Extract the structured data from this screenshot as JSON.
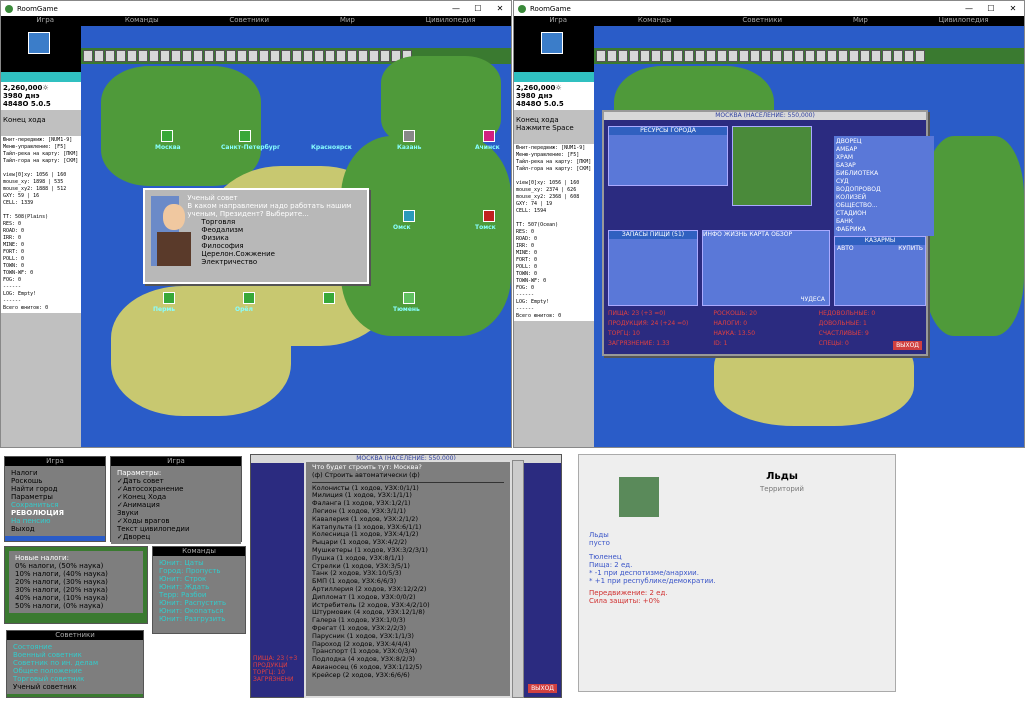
{
  "app_title": "RoomGame",
  "window_controls": [
    "—",
    "☐",
    "✕"
  ],
  "menus": [
    "Игра",
    "Команды",
    "Советники",
    "Мир",
    "Цивилопедия"
  ],
  "left_window": {
    "stats": [
      "2,260,000☼",
      "3980 днэ",
      "4848О 5.0.5"
    ],
    "status": "Конец хода",
    "debug": "Юнит-передвиж: [NUM1-9]\nМеню-управление: [F5]\nТайл-река на карту: [ПКМ]\nТайл-гора на карту: [СКМ]\n\nview[0]xy: 1056 | 160\nmouse_xy: 1898 | 535\nmouse_xy2: 1888 | 512\nGXY: 59 | 16\nCELL: 1339\n\nTT: 508(Plains)\nRES: 0\nROAD: 0\nIRR: 0\nMINE: 0\nFORT: 0\nPOLL: 0\nTOWN: 0\nTOWN-WF: 0\nFOG: 0\n------\nLOG: Empty!\n------\nВсего юнитов: 0",
    "cities": [
      "Москва",
      "Санкт-Петербург",
      "Красноярск",
      "Казань",
      "Ачинск",
      "Омск",
      "Томск",
      "Пермь",
      "Орёл",
      "Тюмень"
    ],
    "advisor": {
      "title": "Ученый совет",
      "question": "В каком направлении надо работать нашим ученым, Президент? Выберите...",
      "options": [
        "Торговля",
        "Феодализм",
        "Физика",
        "Философия",
        "Церелон.Сожжение",
        "Электричество"
      ]
    }
  },
  "right_window": {
    "stats": [
      "2,260,000☼",
      "3980 днэ",
      "4848О 5.0.5"
    ],
    "status": [
      "Конец хода",
      "Нажмите Space"
    ],
    "debug": "Юнит-передвиж: [NUM1-9]\nМеню-управление: [F5]\nТайл-река на карту: [ПКМ]\nТайл-гора на карту: [СКМ]\n\nview[0]xy: 1056 | 160\nmouse_xy: 2374 | 626\nmouse_xy2: 2368 | 608\nGXY: 74 | 19\nCELL: 1594\n\nTT: 507(Ocean)\nRES: 0\nROAD: 0\nIRR: 0\nMINE: 0\nFORT: 0\nPOLL: 0\nTOWN: 0\nTOWN-WF: 0\nFOG: 0\n------\nLOG: Empty!\n------\nВсего юнитов: 0",
    "city_window": {
      "title": "МОСКВА (НАСЕЛЕНИЕ: 550,000)",
      "resources": "РЕСУРСЫ ГОРОДА",
      "food_box": "ЗАПАСЫ ПИЩИ (51)",
      "tabs": [
        "ИНФО",
        "ЖИЗНЬ",
        "КАРТА",
        "ОБЗОР"
      ],
      "barracks": "КАЗАРМЫ",
      "auto": "АВТО",
      "buy": "КУПИТЬ",
      "wonders": "ЧУДЕСА",
      "buildings": [
        "ДВОРЕЦ",
        "АМБАР",
        "ХРАМ",
        "БАЗАР",
        "БИБЛИОТЕКА",
        "СУД",
        "ВОДОПРОВОД",
        "КОЛИЗЕЙ",
        "ОБЩЕСТВО...",
        "СТАДИОН",
        "БАНК",
        "ФАБРИКА",
        "СОЦ"
      ],
      "info": [
        "ПИЩА: 23 (+3 =0)",
        "ПРОДУКЦИЯ: 24 (+24 =0)",
        "ТОРГЦ: 10",
        "РОСКОШЬ: 20",
        "НАЛОГИ: 0",
        "НАУКА: 13.50",
        "НЕДОВОЛЬНЫЕ: 0",
        "ДОВОЛЬНЫЕ: 1",
        "СЧАСТЛИВЫЕ: 9",
        "СПЕЦЫ: 0",
        "ЗАГРЯЗНЕНИЕ: 1.33",
        "ID: 1"
      ],
      "exit": "ВЫХОД"
    }
  },
  "game_menu": {
    "header": "Игра",
    "items": [
      "Налоги",
      "Роскошь",
      "Найти город",
      "Параметры",
      "Сохраниться",
      "РЕВОЛЮЦИЯ",
      "",
      "На пенсию",
      "Выход"
    ]
  },
  "params_menu": {
    "header": "Игра",
    "title": "Параметры:",
    "items": [
      "✓Дать совет",
      "✓Автосохранение",
      "✓Конец Хода",
      "✓Анимация",
      "Звуки",
      "✓Ходы врагов",
      "Текст цивилопедии",
      "✓Дворец"
    ]
  },
  "tax_menu": {
    "title": "Новые налоги:",
    "items": [
      "0% налоги, (50% наука)",
      "10% налоги, (40% наука)",
      "20% налоги, (30% наука)",
      "30% налоги, (20% наука)",
      "40% налоги, (10% наука)",
      "50% налоги, (0% наука)"
    ]
  },
  "commands_menu": {
    "header": "Команды",
    "items": [
      "Юнит: Цаты",
      "Город: Пропусть",
      "Юнит: Строк",
      "Юнит: Ждать",
      "Терр: Разбои",
      "Юнит: Распустить",
      "Юнит: Окопаться",
      "Юнит: Разгрузить"
    ]
  },
  "advisors_menu": {
    "header": "Советники",
    "items": [
      "Состояние",
      "Военный советник",
      "Советник по ин. делам",
      "Общее положение",
      "Торговый советник",
      "Ученый советник"
    ]
  },
  "build_popup": {
    "header": "Что будет строить тут: Москва?",
    "auto": "(ф) Строить автоматически (ф)",
    "items": [
      "Колонисты (1 ходов, УЗХ:0/1/1)",
      "Милиция (1 ходов, УЗХ:1/1/1)",
      "Фаланга (1 ходов, УЗХ:1/2/1)",
      "Легион (1 ходов, УЗХ:3/1/1)",
      "Кавалерия (1 ходов, УЗХ:2/1/2)",
      "Катапульта (1 ходов, УЗХ:6/1/1)",
      "Колесница (1 ходов, УЗХ:4/1/2)",
      "Рыцари (1 ходов, УЗХ:4/2/2)",
      "Мушкетеры (1 ходов, УЗХ:3/2/3/1)",
      "Пушка (1 ходов, УЗХ:8/1/1)",
      "Стрелки (1 ходов, УЗХ:3/5/1)",
      "Танк (2 ходов, УЗХ:10/5/3)",
      "БМП (1 ходов, УЗХ:6/6/3)",
      "Артиллерия (2 ходов, УЗХ:12/2/2)",
      "Дипломат (1 ходов, УЗХ:0/0/2)",
      "Истребитель (2 ходов, УЗХ:4/2/10)",
      "Штурмовик (4 ходов, УЗХ:12/1/8)",
      "Галера (1 ходов, УЗХ:1/0/3)",
      "Фрегат (1 ходов, УЗХ:2/2/3)",
      "Парусник (1 ходов, УЗХ:1/1/3)",
      "Пароход (2 ходов, УЗХ:4/4/4)",
      "Транспорт (1 ходов, УЗХ:0/3/4)",
      "Подлодка (4 ходов, УЗХ:8/2/3)",
      "Авианосец (6 ходов, УЗХ:1/12/5)",
      "Крейсер (2 ходов, УЗХ:6/6/6)"
    ]
  },
  "fragment": {
    "title": "МОСКВА (НАСЕЛЕНИЕ: 550,000)",
    "food": "ПИЩА: 23 (+3",
    "prod": "ПРОДУКЦИ",
    "trade": "ТОРГЦ: 10",
    "poll": "ЗАГРЯЗНЕНИ",
    "exit": "ВЫХОД"
  },
  "terrain": {
    "title": "Льды",
    "subtitle": "Территорий",
    "lines": [
      "Льды",
      "пусто",
      "Тюленец",
      "Пища: 2 ед.",
      "* -1 при деспотизме/анархии.",
      "* +1 при республике/демократии.",
      "Передвижение: 2 ед.",
      "Сила защиты: +0%"
    ]
  }
}
